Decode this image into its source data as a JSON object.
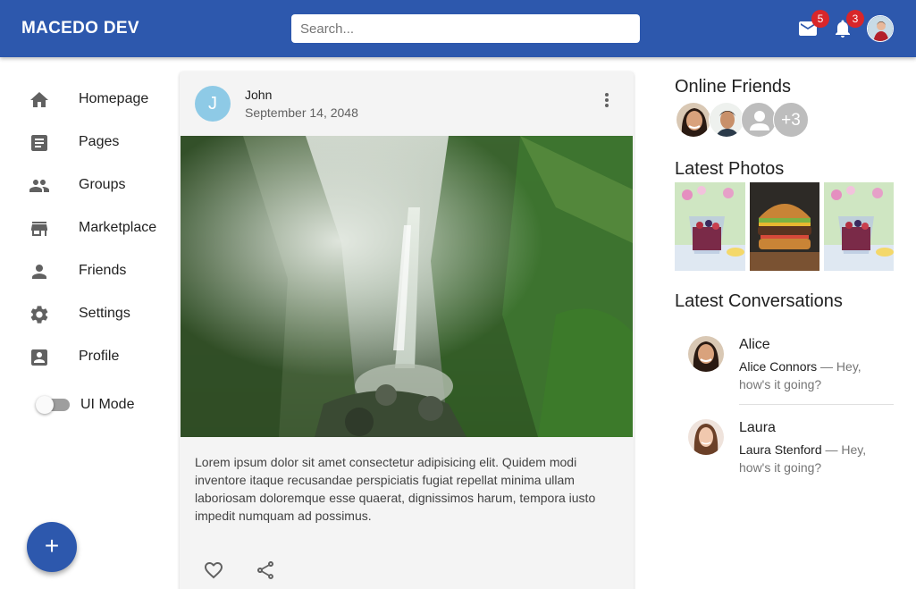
{
  "app": {
    "title": "MACEDO DEV"
  },
  "search": {
    "placeholder": "Search..."
  },
  "notifications": {
    "mail_count": "5",
    "bell_count": "3"
  },
  "sidebar": {
    "items": [
      {
        "label": "Homepage",
        "icon": "home-icon"
      },
      {
        "label": "Pages",
        "icon": "article-icon"
      },
      {
        "label": "Groups",
        "icon": "group-icon"
      },
      {
        "label": "Marketplace",
        "icon": "store-icon"
      },
      {
        "label": "Friends",
        "icon": "person-icon"
      },
      {
        "label": "Settings",
        "icon": "gear-icon"
      },
      {
        "label": "Profile",
        "icon": "account-box-icon"
      }
    ],
    "ui_mode_label": "UI Mode",
    "fab_label": "+"
  },
  "post": {
    "avatar_letter": "J",
    "author": "John",
    "date": "September 14, 2048",
    "text": "Lorem ipsum dolor sit amet consectetur adipisicing elit. Quidem modi inventore itaque recusandae perspiciatis fugiat repellat minima ullam laboriosam doloremque esse quaerat, dignissimos harum, tempora iusto impedit numquam ad possimus."
  },
  "right": {
    "online_friends_title": "Online Friends",
    "more_friends": "+3",
    "latest_photos_title": "Latest Photos",
    "latest_conversations_title": "Latest Conversations",
    "conversations": [
      {
        "name": "Alice",
        "sender": "Alice Connors",
        "message": " — Hey, how's it going?"
      },
      {
        "name": "Laura",
        "sender": "Laura Stenford",
        "message": " — Hey, how's it going?"
      }
    ]
  },
  "colors": {
    "appbar": "#2d58ad",
    "badge": "#d8262a",
    "post_avatar": "#8ecae6"
  }
}
